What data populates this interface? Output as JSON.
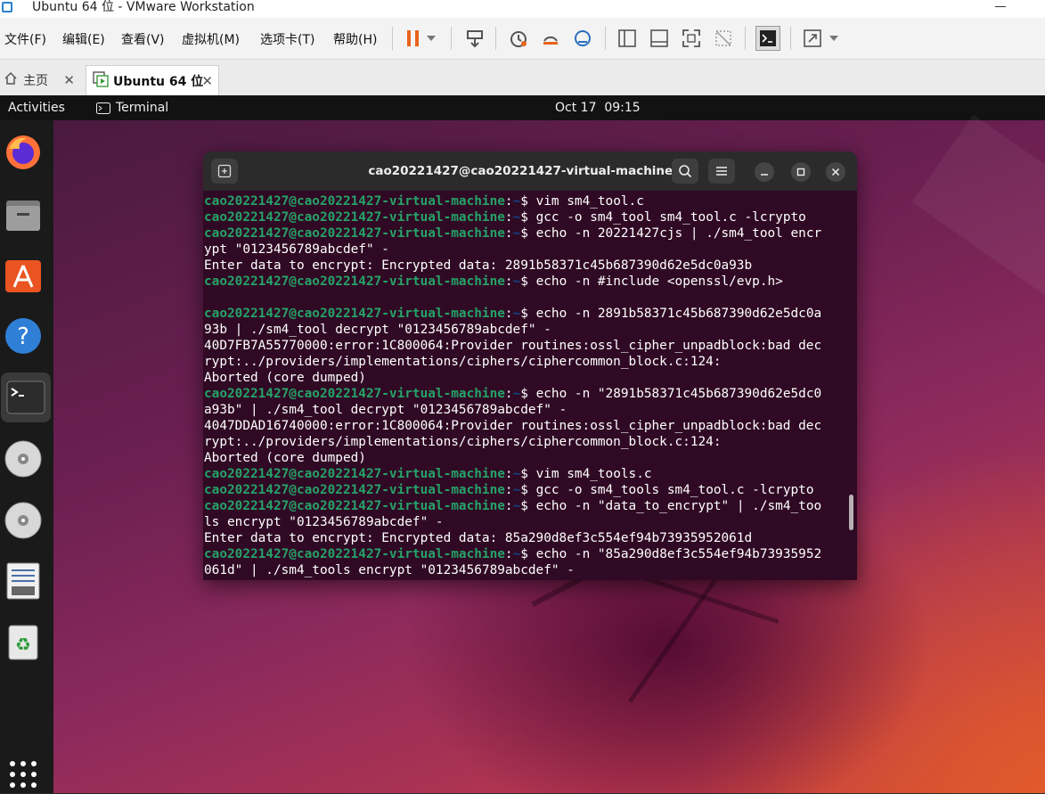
{
  "vmware": {
    "window_title": "Ubuntu 64 位 - VMware Workstation",
    "menu": [
      "文件(F)",
      "编辑(E)",
      "查看(V)",
      "虚拟机(M)",
      "选项卡(T)",
      "帮助(H)"
    ],
    "tabs": [
      {
        "label": "主页",
        "icon": "home-icon"
      },
      {
        "label": "Ubuntu 64 位",
        "icon": "vm-icon"
      }
    ],
    "toolbar_icons": [
      "pause-icon",
      "dropdown-icon",
      "send-keys-icon",
      "snapshot-icon",
      "revert-snapshot-icon",
      "snapshot-manager-icon",
      "sidebar-icon",
      "thumbnail-icon",
      "fullscreen-icon",
      "unity-icon",
      "console-icon",
      "stretch-icon",
      "dropdown-icon"
    ]
  },
  "ubuntu": {
    "activities": "Activities",
    "app_name": "Terminal",
    "clock": "Oct 17  09:15",
    "dock": [
      "firefox-icon",
      "files-icon",
      "app-center-icon",
      "help-icon",
      "terminal-icon",
      "disc-icon",
      "disc-icon",
      "text-editor-icon",
      "trash-icon",
      "apps-grid-icon"
    ]
  },
  "terminal": {
    "title": "cao20221427@cao20221427-virtual-machine: ~",
    "prompt_user": "cao20221427@cao20221427-virtual-machine",
    "prompt_path": "~",
    "lines": [
      {
        "type": "prompt",
        "text": " vim sm4_tool.c"
      },
      {
        "type": "prompt",
        "text": " gcc -o sm4_tool sm4_tool.c -lcrypto"
      },
      {
        "type": "prompt",
        "text": " echo -n 20221427cjs | ./sm4_tool encr"
      },
      {
        "type": "out",
        "text": "ypt \"0123456789abcdef\" -"
      },
      {
        "type": "out",
        "text": "Enter data to encrypt: Encrypted data: 2891b58371c45b687390d62e5dc0a93b"
      },
      {
        "type": "prompt",
        "text": " echo -n #include <openssl/evp.h>"
      },
      {
        "type": "out",
        "text": ""
      },
      {
        "type": "prompt",
        "text": " echo -n 2891b58371c45b687390d62e5dc0a"
      },
      {
        "type": "out",
        "text": "93b | ./sm4_tool decrypt \"0123456789abcdef\" -"
      },
      {
        "type": "out",
        "text": "40D7FB7A55770000:error:1C800064:Provider routines:ossl_cipher_unpadblock:bad dec"
      },
      {
        "type": "out",
        "text": "rypt:../providers/implementations/ciphers/ciphercommon_block.c:124:"
      },
      {
        "type": "out",
        "text": "Aborted (core dumped)"
      },
      {
        "type": "prompt",
        "text": " echo -n \"2891b58371c45b687390d62e5dc0"
      },
      {
        "type": "out",
        "text": "a93b\" | ./sm4_tool decrypt \"0123456789abcdef\" -"
      },
      {
        "type": "out",
        "text": "4047DDAD16740000:error:1C800064:Provider routines:ossl_cipher_unpadblock:bad dec"
      },
      {
        "type": "out",
        "text": "rypt:../providers/implementations/ciphers/ciphercommon_block.c:124:"
      },
      {
        "type": "out",
        "text": "Aborted (core dumped)"
      },
      {
        "type": "prompt",
        "text": " vim sm4_tools.c"
      },
      {
        "type": "prompt",
        "text": " gcc -o sm4_tools sm4_tool.c -lcrypto"
      },
      {
        "type": "prompt",
        "text": " echo -n \"data_to_encrypt\" | ./sm4_too"
      },
      {
        "type": "out",
        "text": "ls encrypt \"0123456789abcdef\" -"
      },
      {
        "type": "out",
        "text": "Enter data to encrypt: Encrypted data: 85a290d8ef3c554ef94b73935952061d"
      },
      {
        "type": "prompt",
        "text": " echo -n \"85a290d8ef3c554ef94b73935952"
      },
      {
        "type": "out",
        "text": "061d\" | ./sm4_tools encrypt \"0123456789abcdef\" -"
      }
    ]
  },
  "colors": {
    "terminal_bg": "#300a24",
    "prompt_green": "#26a269",
    "prompt_blue": "#12488b",
    "pause_orange": "#e8641b"
  }
}
